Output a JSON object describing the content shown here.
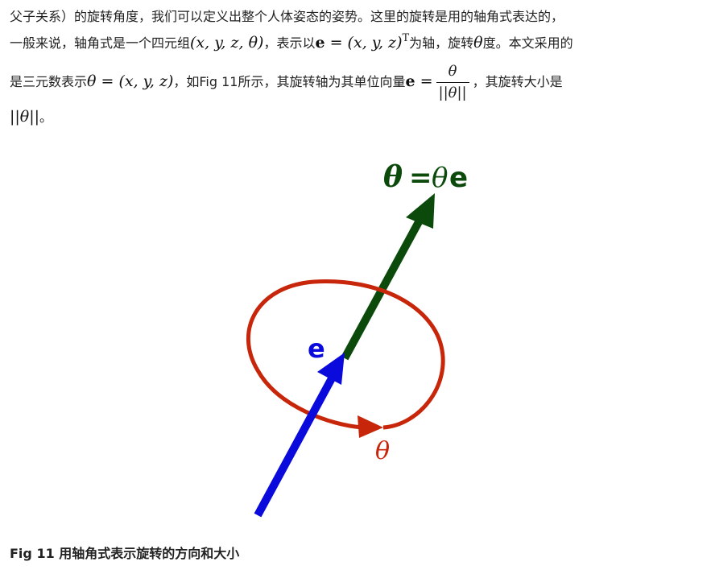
{
  "paragraph": {
    "line1": "父子关系）的旋转角度，我们可以定义出整个人体姿态的姿势。这里的旋转是用的轴角式表达的，",
    "line2_a": "一般来说，轴角式是一个四元组",
    "line2_math1": "(x, y, z, θ)",
    "line2_b": "，表示以",
    "line2_vec": "e",
    "line2_eq": " = (x, y, z)",
    "line2_sup": "T",
    "line2_c": "为轴，旋转",
    "line2_theta": "θ",
    "line2_d": "度。本文采用的",
    "line3_a": "是三元数表示",
    "line3_math": "θ = (x, y, z)",
    "line3_b": "，如Fig 11所示，其旋转轴为其单位向量",
    "line3_vec": "e",
    "line3_eq": " =",
    "line3_frac_num": "θ",
    "line3_frac_den": "||θ||",
    "line3_c": "，其旋转大小是",
    "line4_math": "||θ||",
    "line4_end": "。"
  },
  "figure": {
    "label_top_theta": "θ",
    "label_top_eq": "=",
    "label_top_theta2": "θ",
    "label_top_e": "e",
    "label_e": "e",
    "label_theta": "θ",
    "colors": {
      "axis_green": "#0b4a0b",
      "vector_blue": "#0a0adc",
      "rotation_red": "#c8260a"
    }
  },
  "caption": {
    "text": "Fig 11 用轴角式表示旋转的方向和大小"
  }
}
